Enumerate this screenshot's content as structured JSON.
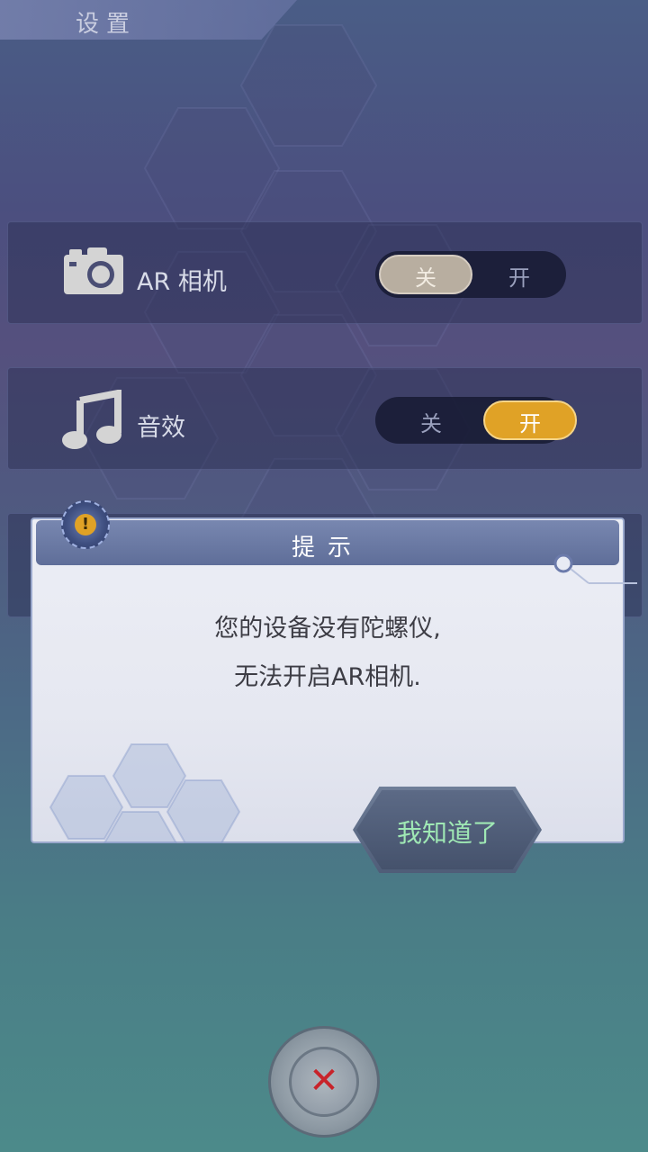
{
  "header": {
    "title": "设置"
  },
  "settings": [
    {
      "label": "AR 相机",
      "icon": "camera-icon",
      "off_label": "关",
      "on_label": "开",
      "state": "off"
    },
    {
      "label": "音效",
      "icon": "music-note-icon",
      "off_label": "关",
      "on_label": "开",
      "state": "on"
    }
  ],
  "dialog": {
    "title": "提示",
    "message_line1": "您的设备没有陀螺仪,",
    "message_line2": "无法开启AR相机.",
    "ok_button": "我知道了",
    "warn_symbol": "!"
  },
  "close_button": {
    "symbol": "✕",
    "icon": "close-icon"
  },
  "colors": {
    "toggle_on": "#e0a226",
    "toggle_off": "#b8aea0",
    "ok_text": "#9fe8b4",
    "close_x": "#c8232a"
  }
}
